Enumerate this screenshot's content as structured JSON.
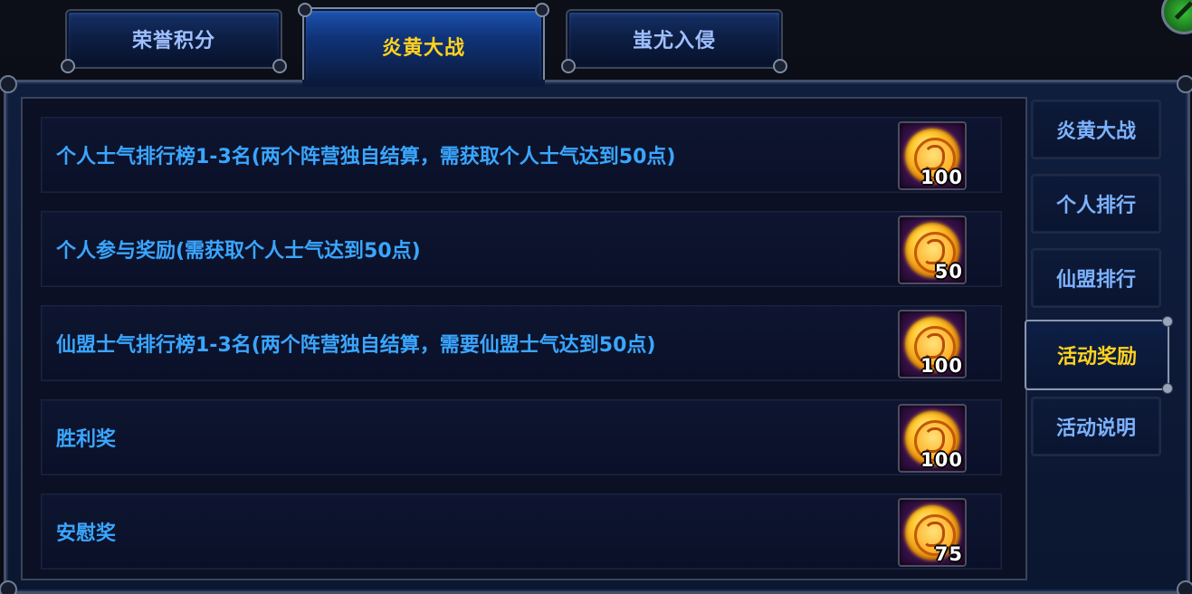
{
  "top_tabs": [
    {
      "label": "荣誉积分",
      "active": false
    },
    {
      "label": "炎黄大战",
      "active": true
    },
    {
      "label": "蚩尤入侵",
      "active": false
    }
  ],
  "rewards": [
    {
      "text": "个人士气排行榜1-3名(两个阵营独自结算，需获取个人士气达到50点)",
      "quantity": "100",
      "icon": "gold-coin-icon"
    },
    {
      "text": "个人参与奖励(需获取个人士气达到50点)",
      "quantity": "50",
      "icon": "gold-coin-icon"
    },
    {
      "text": "仙盟士气排行榜1-3名(两个阵营独自结算，需要仙盟士气达到50点)",
      "quantity": "100",
      "icon": "gold-coin-icon"
    },
    {
      "text": "胜利奖",
      "quantity": "100",
      "icon": "gold-coin-icon"
    },
    {
      "text": "安慰奖",
      "quantity": "75",
      "icon": "gold-coin-icon"
    }
  ],
  "side_tabs": [
    {
      "label": "炎黄大战",
      "active": false
    },
    {
      "label": "个人排行",
      "active": false
    },
    {
      "label": "仙盟排行",
      "active": false
    },
    {
      "label": "活动奖励",
      "active": true
    },
    {
      "label": "活动说明",
      "active": false
    }
  ],
  "colors": {
    "active_tab_text": "#ffd21f",
    "inactive_tab_text": "#9fc0ff",
    "reward_text": "#3aa6ff"
  }
}
